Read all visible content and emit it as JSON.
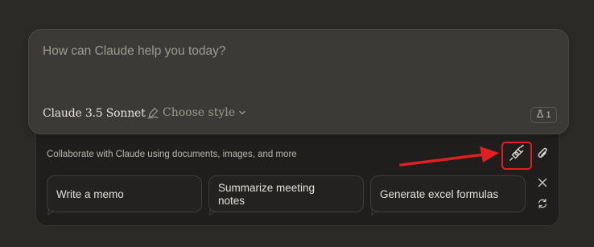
{
  "composer": {
    "placeholder": "How can Claude help you today?",
    "model_name": "Claude 3.5 Sonnet",
    "style_label": "Choose style",
    "experiment_count": "1"
  },
  "collab_bar": {
    "text": "Collaborate with Claude using documents, images, and more"
  },
  "suggestions": [
    {
      "label": "Write a memo"
    },
    {
      "label": "Summarize meeting notes"
    },
    {
      "label": "Generate excel formulas"
    }
  ],
  "icons": {
    "style": "pen-scribble-icon",
    "chevron": "chevron-down-icon",
    "experiment": "flask-icon",
    "integrations": "plug-icon",
    "attach": "paperclip-icon",
    "close": "close-icon",
    "refresh": "refresh-icon"
  },
  "colors": {
    "background": "#2b2a27",
    "composer_bg": "#3b3a36",
    "panel_bg": "#1f1e1c",
    "highlight": "#e02020"
  }
}
